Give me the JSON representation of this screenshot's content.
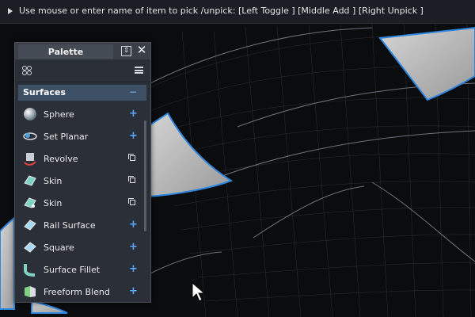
{
  "prompt": {
    "text": "Use mouse or enter name of item to pick /unpick: [Left Toggle ] [Middle Add ] [Right Unpick ]"
  },
  "palette": {
    "tab_label": "Palette",
    "pin_glyph": "⇕",
    "close_glyph": "✕",
    "section": {
      "label": "Surfaces",
      "collapse_glyph": "−"
    },
    "items": [
      {
        "label": "Sphere",
        "icon": "sphere-icon",
        "action": "add"
      },
      {
        "label": "Set Planar",
        "icon": "set-planar-icon",
        "action": "add"
      },
      {
        "label": "Revolve",
        "icon": "revolve-icon",
        "action": "options"
      },
      {
        "label": "Skin",
        "icon": "skin-icon",
        "action": "options"
      },
      {
        "label": "Skin",
        "icon": "skin-icon",
        "action": "options"
      },
      {
        "label": "Rail Surface",
        "icon": "rail-surface-icon",
        "action": "add"
      },
      {
        "label": "Square",
        "icon": "square-icon",
        "action": "add"
      },
      {
        "label": "Surface Fillet",
        "icon": "surface-fillet-icon",
        "action": "add"
      },
      {
        "label": "Freeform Blend",
        "icon": "freeform-blend-icon",
        "action": "add"
      }
    ]
  },
  "colors": {
    "selection_highlight": "#2e86de",
    "surface_fill": "#b9b9b9",
    "add_action": "#5aa8ff"
  }
}
